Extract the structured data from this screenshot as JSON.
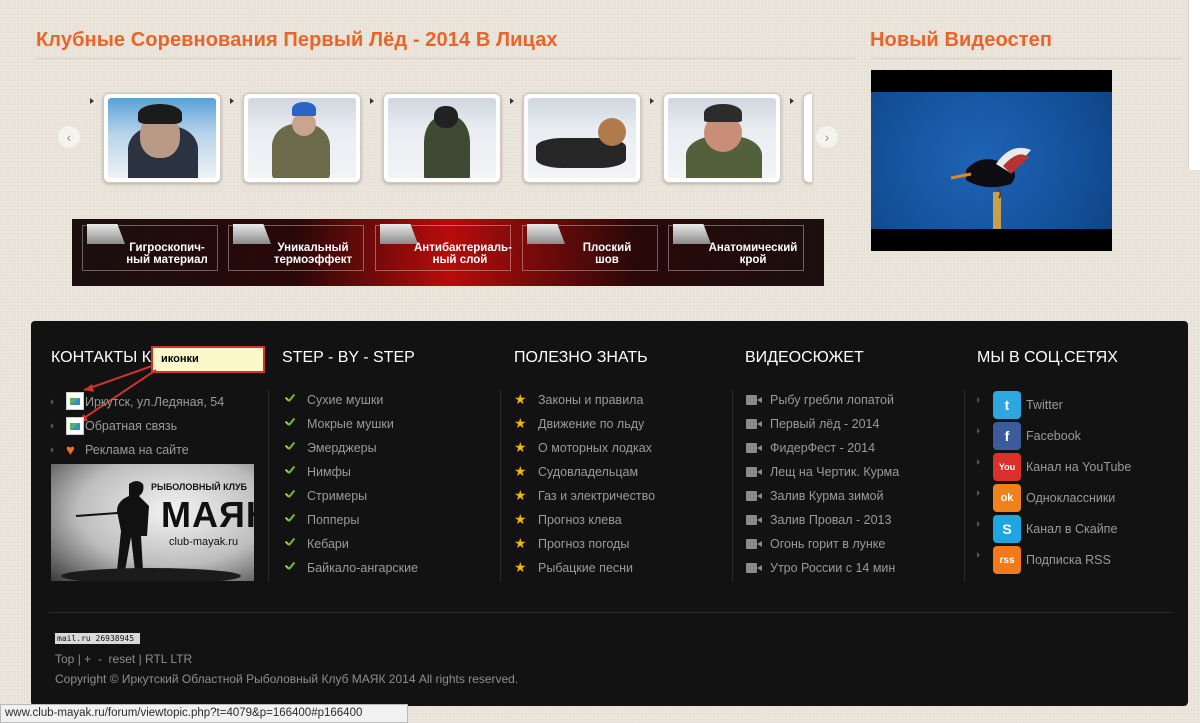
{
  "gallery": {
    "title": "Клубные Соревнования Первый Лёд - 2014 В Лицах",
    "prev_arrow": "‹",
    "next_arrow": "›"
  },
  "video": {
    "title": "Новый Видеостеп"
  },
  "features": [
    {
      "line1": "Гигроскопич-",
      "line2": "ный материал"
    },
    {
      "line1": "Уникальный",
      "line2": "термоэффект"
    },
    {
      "line1": "Антибактериаль-",
      "line2": "ный слой"
    },
    {
      "line1": "Плоский",
      "line2": "шов"
    },
    {
      "line1": "Анатомический",
      "line2": "крой"
    }
  ],
  "footer": {
    "contacts": {
      "title": "КОНТАКТЫ К",
      "annotation": "иконки",
      "items": [
        "Иркутск, ул.Ледяная, 54",
        "Обратная связь",
        "Реклама на сайте"
      ],
      "logo": {
        "top": "РЫБОЛОВНЫЙ КЛУБ",
        "name": "МАЯК",
        "site": "club-mayak.ru"
      }
    },
    "step": {
      "title": "STEP - BY - STEP",
      "items": [
        "Сухие мушки",
        "Мокрые мушки",
        "Эмерджеры",
        "Нимфы",
        "Стримеры",
        "Попперы",
        "Кебари",
        "Байкало-ангарские"
      ]
    },
    "useful": {
      "title": "ПОЛЕЗНО ЗНАТЬ",
      "items": [
        "Законы и правила",
        "Движение по льду",
        "О моторных лодках",
        "Судовладельцам",
        "Газ и электричество",
        "Прогноз клева",
        "Прогноз погоды",
        "Рыбацкие песни"
      ]
    },
    "video": {
      "title": "ВИДЕОСЮЖЕТ",
      "items": [
        "Рыбу гребли лопатой",
        "Первый лёд - 2014",
        "ФидерФест - 2014",
        "Лещ на Чертик. Курма",
        "Залив Курма зимой",
        "Залив Провал - 2013",
        "Огонь горит в лунке",
        "Утро России с 14 мин"
      ]
    },
    "social": {
      "title": "МЫ В СОЦ.СЕТЯХ",
      "items": [
        {
          "label": "Twitter",
          "icon": "twitter-icon",
          "color": "#2ea7e0",
          "glyph": "t"
        },
        {
          "label": "Facebook",
          "icon": "facebook-icon",
          "color": "#3b5b9a",
          "glyph": "f"
        },
        {
          "label": "Канал на YouTube",
          "icon": "youtube-icon",
          "color": "#d9302a",
          "glyph": "You"
        },
        {
          "label": "Одноклассники",
          "icon": "odnoklassniki-icon",
          "color": "#f0821c",
          "glyph": "ok"
        },
        {
          "label": "Канал в Скайпе",
          "icon": "skype-icon",
          "color": "#1ea6e2",
          "glyph": "S"
        },
        {
          "label": "Подписка RSS",
          "icon": "rss-icon",
          "color": "#f27a1a",
          "glyph": "rss"
        }
      ]
    },
    "counter": "mail.ru  26938945",
    "links": [
      "Top",
      "|",
      "+",
      "-",
      "reset",
      "|",
      "RTL",
      "LTR"
    ],
    "copyright": "Copyright © Иркутский Областной Рыболовный Клуб МАЯК 2014 All rights reserved."
  },
  "statusbar": {
    "url": "www.club-mayak.ru/forum/viewtopic.php?t=4079&p=166400#p166400"
  }
}
